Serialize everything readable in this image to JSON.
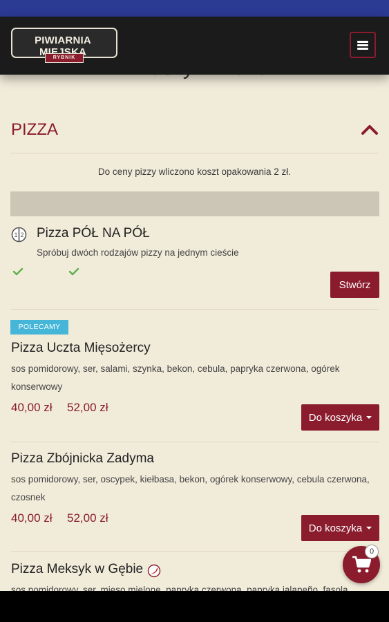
{
  "header": {
    "logo_text": "PIWIARNIA MIEJSKA",
    "logo_subtext": "RYBNIK",
    "menu_icon": "hamburger-icon"
  },
  "page": {
    "heading": "Z naszym menu"
  },
  "section": {
    "title": "PIZZA",
    "toggle_icon": "chevron-up-icon",
    "note": "Do ceny pizzy wliczono koszt opakowania 2 zł."
  },
  "half_pizza": {
    "icon": "half-and-half-icon",
    "title": "Pizza PÓŁ NA PÓŁ",
    "description": "Spróbuj dwóch rodzajów pizzy na jednym cieście",
    "button": "Stwórz"
  },
  "items": [
    {
      "badge": "POLECAMY",
      "name": "Pizza Uczta Mięsożercy",
      "ingredients": "sos pomidorowy, ser, salami, szynka, bekon, cebula, papryka czerwona, ogórek konserwowy",
      "price_1": "40,00 zł",
      "price_2": "52,00 zł",
      "button": "Do koszyka"
    },
    {
      "name": "Pizza Zbójnicka Zadyma",
      "ingredients": "sos pomidorowy, ser, oscypek, kiełbasa, bekon, ogórek konserwowy, cebula czerwona, czosnek",
      "price_1": "40,00 zł",
      "price_2": "52,00 zł",
      "button": "Do koszyka"
    },
    {
      "name": "Pizza Meksyk w Gębie",
      "icon": "chili-icon",
      "ingredients": "sos pomidorowy, ser, mięso mielone, papryka czerwona, papryka jalapeño, fasola"
    }
  ],
  "cart": {
    "icon": "cart-icon",
    "count": "0"
  },
  "colors": {
    "accent": "#8a1c2e",
    "background": "#f1ebda",
    "badge": "#45b5d8",
    "status_bar": "#2b3a93"
  }
}
